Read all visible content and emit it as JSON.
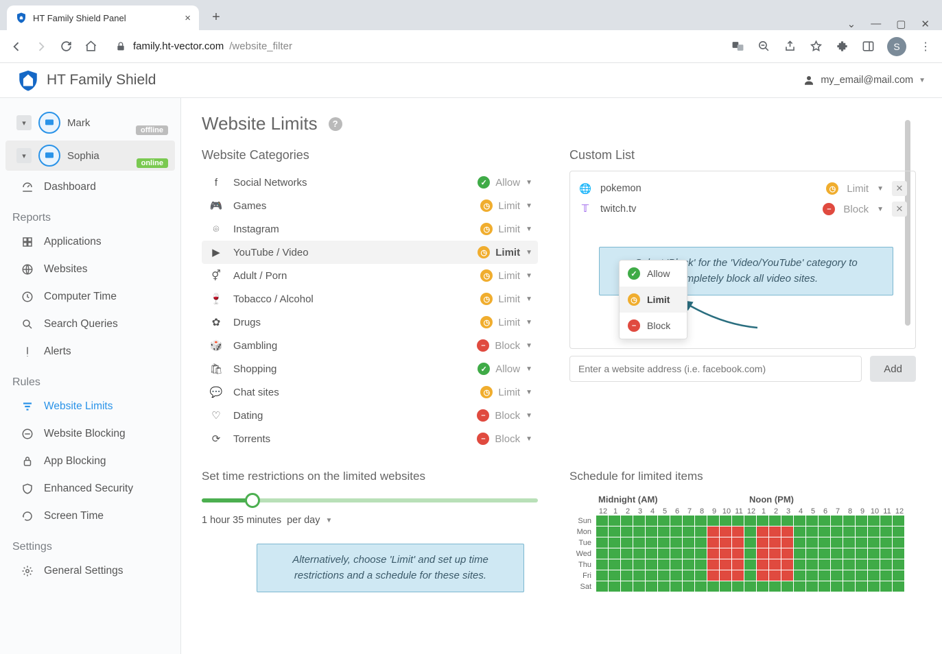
{
  "browser": {
    "tab_title": "HT Family Shield Panel",
    "url_host": "family.ht-vector.com",
    "url_path": "/website_filter",
    "avatar_letter": "S"
  },
  "app": {
    "title": "HT Family Shield",
    "user_email": "my_email@mail.com"
  },
  "profiles": [
    {
      "name": "Mark",
      "status": "offline"
    },
    {
      "name": "Sophia",
      "status": "online"
    }
  ],
  "sidebar": {
    "dashboard": "Dashboard",
    "sections": {
      "reports": "Reports",
      "rules": "Rules",
      "settings": "Settings"
    },
    "reports_items": [
      "Applications",
      "Websites",
      "Computer Time",
      "Search Queries",
      "Alerts"
    ],
    "rules_items": [
      "Website Limits",
      "Website Blocking",
      "App Blocking",
      "Enhanced Security",
      "Screen Time"
    ],
    "settings_items": [
      "General Settings"
    ]
  },
  "page": {
    "title": "Website Limits",
    "categories_title": "Website Categories",
    "custom_title": "Custom List",
    "restrict_title": "Set time restrictions on the limited websites",
    "sched_title": "Schedule for limited items",
    "add_placeholder": "Enter a website address (i.e. facebook.com)",
    "add_btn": "Add"
  },
  "actions": {
    "allow": "Allow",
    "limit": "Limit",
    "block": "Block"
  },
  "categories": [
    {
      "name": "Social Networks",
      "state": "allow"
    },
    {
      "name": "Games",
      "state": "limit"
    },
    {
      "name": "Instagram",
      "state": "limit"
    },
    {
      "name": "YouTube / Video",
      "state": "limit",
      "open": true,
      "strong": true
    },
    {
      "name": "Adult / Porn",
      "state": "limit"
    },
    {
      "name": "Tobacco / Alcohol",
      "state": "limit"
    },
    {
      "name": "Drugs",
      "state": "limit"
    },
    {
      "name": "Gambling",
      "state": "block"
    },
    {
      "name": "Shopping",
      "state": "allow"
    },
    {
      "name": "Chat sites",
      "state": "limit"
    },
    {
      "name": "Dating",
      "state": "block"
    },
    {
      "name": "Torrents",
      "state": "block"
    }
  ],
  "custom_list": [
    {
      "site": "pokemon",
      "state": "limit",
      "icon": "globe",
      "icon_color": "#2a93e8"
    },
    {
      "site": "twitch.tv",
      "state": "block",
      "icon": "twitch",
      "icon_color": "#8d4de8"
    }
  ],
  "callouts": {
    "top": "Select 'Block' for the 'Video/YouTube' category to completely block all video sites.",
    "bottom": "Alternatively, choose 'Limit' and set up time restrictions and a schedule for these sites."
  },
  "slider": {
    "value_pct": 15,
    "label_value": "1 hour 35 minutes",
    "label_unit": "per day"
  },
  "schedule": {
    "am_label": "Midnight (AM)",
    "pm_label": "Noon (PM)",
    "hours": [
      "12",
      "1",
      "2",
      "3",
      "4",
      "5",
      "6",
      "7",
      "8",
      "9",
      "10",
      "11",
      "12",
      "1",
      "2",
      "3",
      "4",
      "5",
      "6",
      "7",
      "8",
      "9",
      "10",
      "11",
      "12"
    ],
    "days": [
      "Sun",
      "Mon",
      "Tue",
      "Wed",
      "Thu",
      "Fri",
      "Sat"
    ],
    "red_ranges": {
      "Sun": [],
      "Sat": [],
      "Mon": [
        [
          9,
          12
        ],
        [
          13,
          16
        ]
      ],
      "Tue": [
        [
          9,
          12
        ],
        [
          13,
          16
        ]
      ],
      "Wed": [
        [
          9,
          12
        ],
        [
          13,
          16
        ]
      ],
      "Thu": [
        [
          9,
          12
        ],
        [
          13,
          16
        ]
      ],
      "Fri": [
        [
          9,
          12
        ],
        [
          13,
          16
        ]
      ]
    }
  }
}
